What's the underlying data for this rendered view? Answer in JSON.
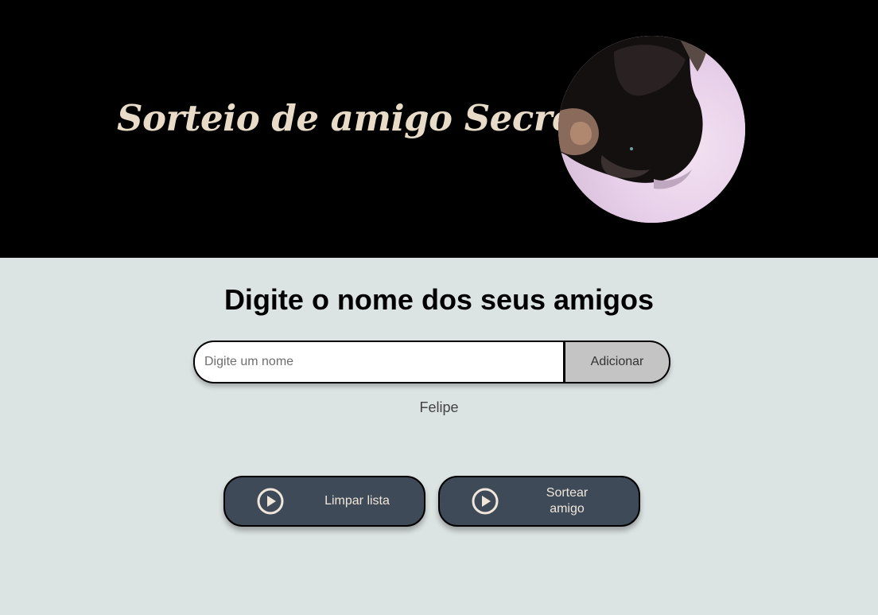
{
  "header": {
    "title": "Sorteio de amigo Secreto",
    "image_icon": "cat-photo"
  },
  "main": {
    "heading": "Digite o nome dos seus amigos",
    "name_input": {
      "placeholder": "Digite um nome",
      "value": ""
    },
    "add_button_label": "Adicionar",
    "friends": [
      "Felipe"
    ],
    "clear_button": {
      "label": "Limpar lista",
      "icon": "play-circle-icon"
    },
    "draw_button": {
      "label": "Sortear amigo",
      "icon": "play-circle-icon"
    }
  },
  "colors": {
    "header_background": "#000000",
    "title_color": "#e8dcc8",
    "page_background": "#dce4e3",
    "button_background": "#3e4a57",
    "button_text": "#f0e6da",
    "add_button_background": "#c4c4c4"
  }
}
